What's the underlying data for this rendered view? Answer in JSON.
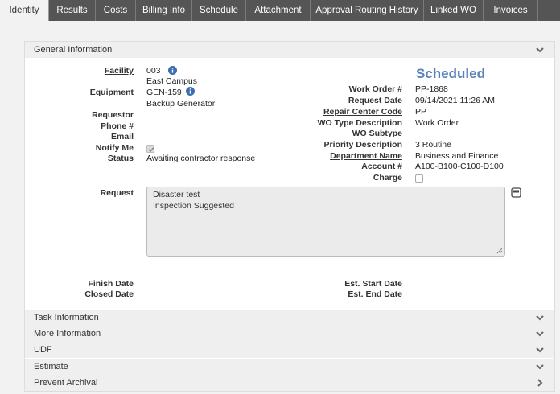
{
  "tabs": [
    {
      "label": "Identity"
    },
    {
      "label": "Results"
    },
    {
      "label": "Costs"
    },
    {
      "label": "Billing Info"
    },
    {
      "label": "Schedule"
    },
    {
      "label": "Attachment"
    },
    {
      "label": "Approval Routing History"
    },
    {
      "label": "Linked WO"
    },
    {
      "label": "Invoices"
    }
  ],
  "general": {
    "title": "General Information",
    "status": "Scheduled",
    "facility_label": "Facility",
    "facility_code": "003",
    "facility_name": "East Campus",
    "equipment_label": "Equipment",
    "equipment_code": "GEN-159",
    "equipment_name": "Backup Generator",
    "requestor_label": "Requestor",
    "phone_label": "Phone #",
    "email_label": "Email",
    "notify_label": "Notify Me",
    "status_label": "Status",
    "status_value": "Awaiting contractor response",
    "work_order_label": "Work Order #",
    "work_order_value": "PP-1868",
    "request_date_label": "Request Date",
    "request_date_value": "09/14/2021 11:26 AM",
    "repair_center_label": "Repair Center Code",
    "repair_center_value": "PP",
    "wo_type_label": "WO Type Description",
    "wo_type_value": "Work Order",
    "wo_subtype_label": "WO Subtype",
    "priority_label": "Priority Description",
    "priority_value": "3 Routine",
    "department_label": "Department Name",
    "department_value": "Business and Finance",
    "account_label": "Account #",
    "account_value": "A100-B100-C100-D100",
    "charge_label": "Charge",
    "request_label": "Request",
    "request_line1": "Disaster test",
    "request_line2": "Inspection Suggested",
    "finish_date_label": "Finish Date",
    "closed_date_label": "Closed Date",
    "est_start_label": "Est. Start Date",
    "est_end_label": "Est. End Date"
  },
  "sections": [
    {
      "label": "Task Information",
      "icon": "chevron-down-icon"
    },
    {
      "label": "More Information",
      "icon": "chevron-down-icon"
    },
    {
      "label": "UDF",
      "icon": "chevron-down-icon"
    },
    {
      "label": "Estimate",
      "icon": "chevron-down-icon"
    },
    {
      "label": "Prevent Archival",
      "icon": "chevron-right-icon"
    }
  ],
  "colors": {
    "tab_bar": "#555555",
    "status_accent": "#5a82b8",
    "info_icon": "#3b6fb0"
  }
}
